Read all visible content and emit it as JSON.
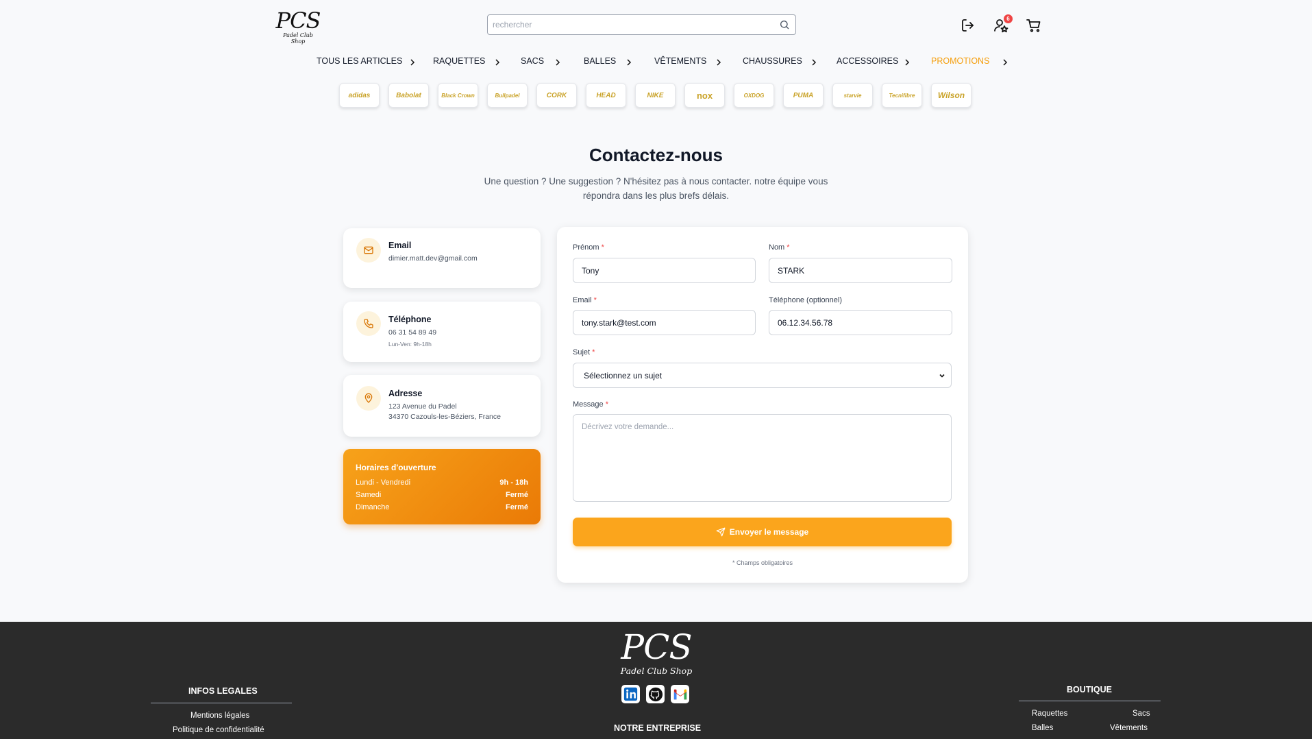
{
  "header": {
    "logo_big": "PCS",
    "logo_small": "Padel Club Shop",
    "search_placeholder": "rechercher",
    "favorites_count": "6"
  },
  "nav": {
    "items": [
      "TOUS LES ARTICLES",
      "RAQUETTES",
      "SACS",
      "BALLES",
      "VÊTEMENTS",
      "CHAUSSURES",
      "ACCESSOIRES",
      "PROMOTIONS"
    ]
  },
  "brands": [
    "adidas",
    "Babolat",
    "Black Crown",
    "Bullpadel",
    "CORK",
    "HEAD",
    "NIKE",
    "nox",
    "OXDOG",
    "PUMA",
    "starvie",
    "Tecnifibre",
    "Wilson"
  ],
  "page": {
    "title": "Contactez-nous",
    "subtitle": "Une question ? Une suggestion ? N'hésitez pas à nous contacter. notre équipe vous répondra dans les plus brefs délais."
  },
  "contact_cards": {
    "email": {
      "title": "Email",
      "value": "dimier.matt.dev@gmail.com"
    },
    "phone": {
      "title": "Téléphone",
      "value": "06 31 54 89 49",
      "hours": "Lun-Ven: 9h-18h"
    },
    "address": {
      "title": "Adresse",
      "line1": "123 Avenue du Padel",
      "line2": "34370 Cazouls-les-Béziers, France"
    }
  },
  "opening_hours": {
    "title": "Horaires d'ouverture",
    "rows": [
      {
        "day": "Lundi - Vendredi",
        "time": "9h - 18h"
      },
      {
        "day": "Samedi",
        "time": "Fermé"
      },
      {
        "day": "Dimanche",
        "time": "Fermé"
      }
    ]
  },
  "form": {
    "first_name_label": "Prénom",
    "first_name_value": "Tony",
    "last_name_label": "Nom",
    "last_name_value": "STARK",
    "email_label": "Email",
    "email_value": "tony.stark@test.com",
    "phone_label": "Téléphone (optionnel)",
    "phone_value": "06.12.34.56.78",
    "subject_label": "Sujet",
    "subject_value": "Sélectionnez un sujet",
    "message_label": "Message",
    "message_placeholder": "Décrivez votre demande...",
    "required_mark": "*",
    "submit_label": "Envoyer le message",
    "required_note": "* Champs obligatoires"
  },
  "footer": {
    "logo_big": "PCS",
    "logo_small": "Padel Club Shop",
    "legal_heading": "INFOS LEGALES",
    "legal_links": [
      "Mentions légales",
      "Politique de confidentialité"
    ],
    "company_heading": "NOTRE ENTREPRISE",
    "shop_heading": "BOUTIQUE",
    "shop_links": [
      "Raquettes",
      "Sacs",
      "Balles",
      "Vêtements"
    ]
  },
  "colors": {
    "accent": "#fba51c",
    "promo": "#f59e0b",
    "footer_bg": "#2b2b2b",
    "brand_gold": "#c9a227"
  }
}
